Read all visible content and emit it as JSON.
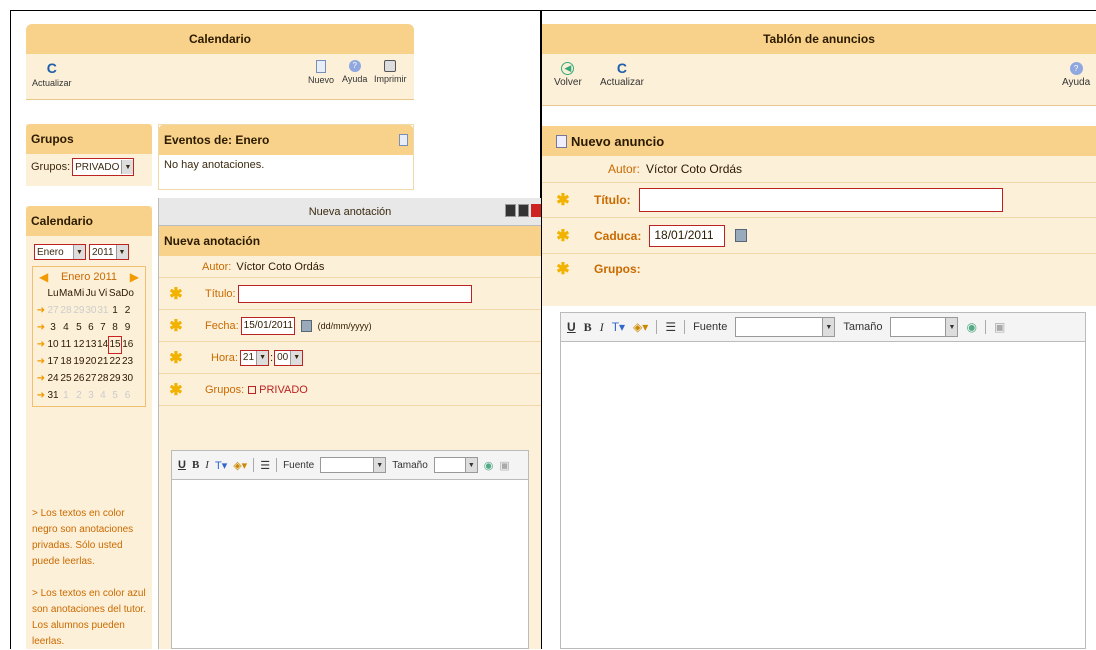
{
  "left": {
    "title": "Calendario",
    "toolbar": {
      "refresh": "Actualizar",
      "new": "Nuevo",
      "help": "Ayuda",
      "print": "Imprimir"
    },
    "groups_panel": {
      "title": "Grupos",
      "label": "Grupos:",
      "value": "PRIVADO"
    },
    "events_panel": {
      "title": "Eventos de: Enero",
      "empty": "No hay anotaciones."
    },
    "calendar_panel": {
      "title": "Calendario",
      "month_select": "Enero",
      "year_select": "2011",
      "month_label": "Enero 2011",
      "weekdays": [
        "Lu",
        "Ma",
        "Mi",
        "Ju",
        "Vi",
        "Sa",
        "Do"
      ],
      "weeks": [
        [
          "27",
          "28",
          "29",
          "30",
          "31",
          "1",
          "2"
        ],
        [
          "3",
          "4",
          "5",
          "6",
          "7",
          "8",
          "9"
        ],
        [
          "10",
          "11",
          "12",
          "13",
          "14",
          "15",
          "16"
        ],
        [
          "17",
          "18",
          "19",
          "20",
          "21",
          "22",
          "23"
        ],
        [
          "24",
          "25",
          "26",
          "27",
          "28",
          "29",
          "30"
        ],
        [
          "31",
          "1",
          "2",
          "3",
          "4",
          "5",
          "6"
        ]
      ]
    },
    "notes": [
      "> Los textos en color negro son anotaciones privadas. Sólo usted puede leerlas.",
      "> Los textos en color azul son anotaciones del tutor. Los alumnos pueden leerlas."
    ],
    "dialog": {
      "window_title": "Nueva anotación",
      "heading": "Nueva anotación",
      "author_label": "Autor:",
      "author": "Víctor Coto Ordás",
      "title_label": "Título:",
      "date_label": "Fecha:",
      "date_value": "15/01/2011",
      "date_hint": "(dd/mm/yyyy)",
      "time_label": "Hora:",
      "hour": "21",
      "minute": "00",
      "groups_label": "Grupos:",
      "group_option": "PRIVADO",
      "editor": {
        "font": "Fuente",
        "size": "Tamaño"
      }
    }
  },
  "right": {
    "title": "Tablón de anuncios",
    "toolbar": {
      "back": "Volver",
      "refresh": "Actualizar",
      "help": "Ayuda"
    },
    "heading": "Nuevo anuncio",
    "author_label": "Autor:",
    "author": "Víctor Coto Ordás",
    "title_label": "Título:",
    "expires_label": "Caduca:",
    "expires_value": "18/01/2011",
    "groups_label": "Grupos:",
    "editor": {
      "font": "Fuente",
      "size": "Tamaño"
    }
  }
}
